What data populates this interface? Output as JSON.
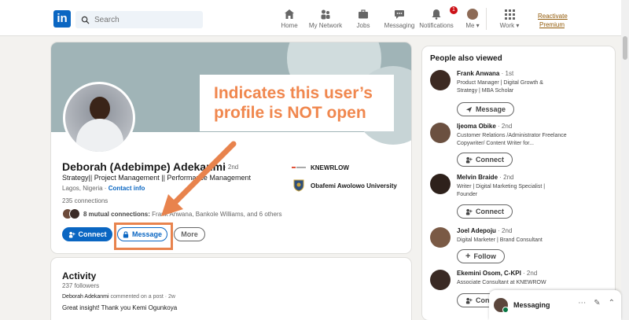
{
  "nav": {
    "logo": "in",
    "search_placeholder": "Search",
    "items": [
      {
        "label": "Home"
      },
      {
        "label": "My Network"
      },
      {
        "label": "Jobs"
      },
      {
        "label": "Messaging"
      },
      {
        "label": "Notifications",
        "badge": "1"
      },
      {
        "label": "Me"
      },
      {
        "label": "Work"
      }
    ],
    "premium_line1": "Reactivate",
    "premium_line2": "Premium"
  },
  "profile": {
    "name": "Deborah (Adebimpe) Adekanmi",
    "degree": "· 2nd",
    "headline": "Strategy|| Project Management || Performance Management",
    "location": "Lagos, Nigeria ·",
    "contact_info": "Contact info",
    "connections": "235 connections",
    "mutual_bold": "8 mutual connections:",
    "mutual_rest": "Frank Anwana, Bankole Williams, and 6 others",
    "buttons": {
      "connect": "Connect",
      "message": "Message",
      "more": "More"
    },
    "orgs": [
      {
        "name": "KNEWRLOW",
        "logo_text": "Knewrow"
      },
      {
        "name": "Obafemi Awolowo University"
      }
    ]
  },
  "annotation": {
    "line1": "Indicates this user’s",
    "line2": "profile is NOT open"
  },
  "activity": {
    "title": "Activity",
    "followers": "237 followers",
    "author": "Deborah Adekanmi",
    "action": "commented on a post · 2w",
    "text": "Great insight! Thank you Kemi Ogunkoya"
  },
  "people_also_viewed": {
    "title": "People also viewed",
    "people": [
      {
        "name": "Frank Anwana",
        "degree": "· 1st",
        "desc": "Product Manager | Digital Growth & Strategy | MBA Scholar",
        "button": "Message"
      },
      {
        "name": "Ijeoma Obike",
        "degree": "· 2nd",
        "desc": "Customer Relations /Administrator Freelance Copywriter/ Content Writer for...",
        "button": "Connect"
      },
      {
        "name": "Melvin Braide",
        "degree": "· 2nd",
        "desc": "Writer | Digital Marketing Specialist | Founder",
        "button": "Connect"
      },
      {
        "name": "Joel Adepoju",
        "degree": "· 2nd",
        "desc": "Digital Marketer | Brand Consultant",
        "button": "Follow"
      },
      {
        "name": "Ekemini Osom, C-KPI",
        "degree": "· 2nd",
        "desc": "Associate Consultant at KNEWROW",
        "button": "Conn"
      }
    ]
  },
  "messaging": {
    "label": "Messaging",
    "icons": [
      "more-icon",
      "compose-icon",
      "chevron-up-icon"
    ]
  },
  "colors": {
    "brand": "#0a66c2",
    "annotation": "#f0874e",
    "premium": "#915907"
  }
}
